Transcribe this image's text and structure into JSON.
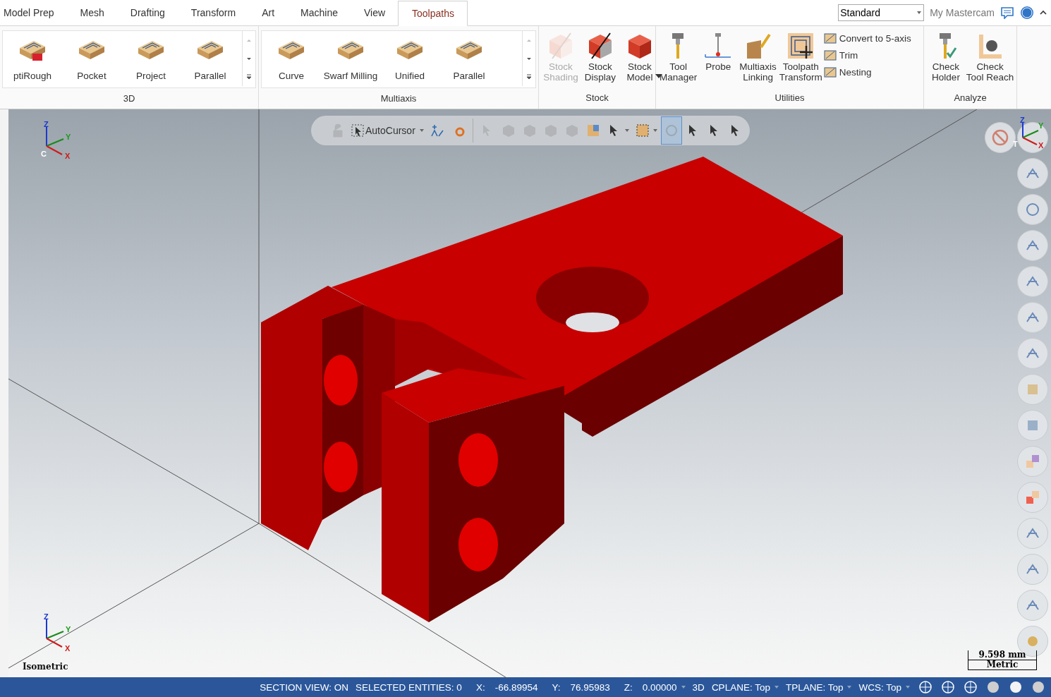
{
  "tabs": [
    {
      "label": "Model Prep",
      "selected": false
    },
    {
      "label": "Mesh",
      "selected": false
    },
    {
      "label": "Drafting",
      "selected": false
    },
    {
      "label": "Transform",
      "selected": false
    },
    {
      "label": "Art",
      "selected": false
    },
    {
      "label": "Machine",
      "selected": false
    },
    {
      "label": "View",
      "selected": false
    },
    {
      "label": "Toolpaths",
      "selected": true
    }
  ],
  "view_selector": {
    "value": "Standard"
  },
  "my_mastercam": "My Mastercam",
  "ribbon": [
    {
      "label": "3D",
      "scroller": true,
      "items": [
        {
          "label": "ptiRough",
          "disabled": false
        },
        {
          "label": "Pocket",
          "disabled": false
        },
        {
          "label": "Project",
          "disabled": false
        },
        {
          "label": "Parallel",
          "disabled": false
        }
      ]
    },
    {
      "label": "Multiaxis",
      "scroller": true,
      "items": [
        {
          "label": "Curve",
          "disabled": false
        },
        {
          "label": "Swarf Milling",
          "disabled": false
        },
        {
          "label": "Unified",
          "disabled": false
        },
        {
          "label": "Parallel",
          "disabled": false
        }
      ]
    },
    {
      "label": "Stock",
      "scroller": false,
      "items": [
        {
          "label": "Stock\nShading",
          "disabled": true
        },
        {
          "label": "Stock\nDisplay",
          "disabled": false
        },
        {
          "label": "Stock\nModel",
          "disabled": false,
          "dropdown": true
        }
      ]
    },
    {
      "label": "Utilities",
      "scroller": false,
      "items": [
        {
          "label": "Tool\nManager",
          "disabled": false
        },
        {
          "label": "Probe",
          "disabled": false
        },
        {
          "label": "Multiaxis\nLinking",
          "disabled": false
        },
        {
          "label": "Toolpath\nTransform",
          "disabled": false
        }
      ],
      "small_items": [
        {
          "label": "Convert to 5-axis"
        },
        {
          "label": "Trim"
        },
        {
          "label": "Nesting"
        }
      ]
    },
    {
      "label": "Analyze",
      "scroller": false,
      "items": [
        {
          "label": "Check\nHolder",
          "disabled": false
        },
        {
          "label": "Check\nTool Reach",
          "disabled": false
        }
      ]
    }
  ],
  "toolbar": {
    "autocursor": "AutoCursor",
    "buttons": [
      {
        "disabled": true,
        "selected": false
      },
      {
        "disabled": false,
        "selected": false
      },
      {
        "disabled": false,
        "selected": false
      },
      {
        "disabled": true,
        "selected": false
      },
      {
        "disabled": true,
        "selected": false
      },
      {
        "disabled": true,
        "selected": false
      },
      {
        "disabled": true,
        "selected": false
      },
      {
        "disabled": true,
        "selected": false
      },
      {
        "disabled": false,
        "selected": false
      },
      {
        "disabled": false,
        "selected": false
      },
      {
        "disabled": false,
        "selected": false
      },
      {
        "disabled": true,
        "selected": true
      },
      {
        "disabled": false,
        "selected": false
      },
      {
        "disabled": false,
        "selected": false
      },
      {
        "disabled": false,
        "selected": false
      }
    ]
  },
  "view_axes": {
    "z": "Z",
    "y": "Y",
    "x": "X",
    "origin": "C"
  },
  "tool_axes": {
    "z": "Z",
    "y": "Y",
    "x": "X",
    "origin": "T"
  },
  "world_axes": {
    "z": "Z",
    "y": "Y",
    "x": "X"
  },
  "view_name": "Isometric",
  "scale": {
    "length": "9.598 mm",
    "units": "Metric"
  },
  "status_bar": {
    "section_view": "SECTION VIEW: ON",
    "selected_entities": "SELECTED ENTITIES: 0",
    "coords": [
      {
        "label": "X:",
        "value": "-66.89954"
      },
      {
        "label": "Y:",
        "value": "76.95983"
      },
      {
        "label": "Z:",
        "value": "0.00000"
      }
    ],
    "mode": "3D",
    "cplane": "CPLANE: Top",
    "tplane": "TPLANE: Top",
    "wcs": "WCS: Top"
  }
}
